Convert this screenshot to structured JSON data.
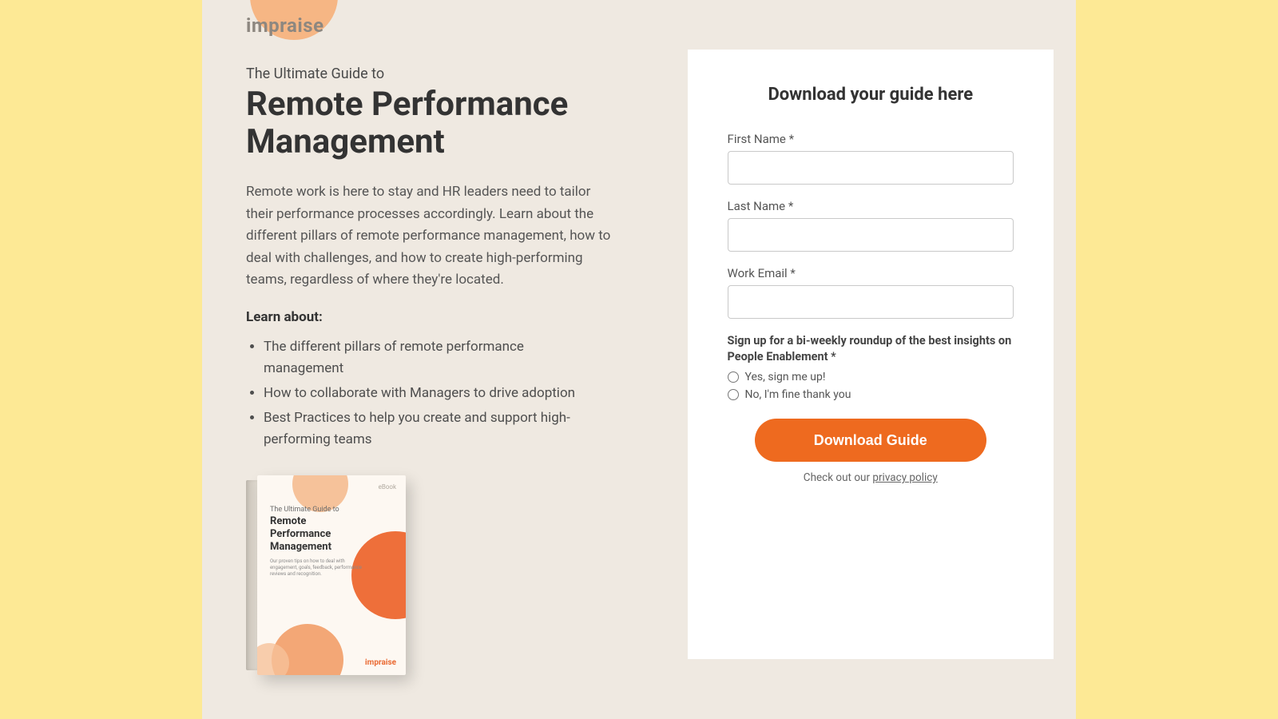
{
  "brand": "impraise",
  "left": {
    "kicker": "The Ultimate Guide to",
    "title": "Remote Performance Management",
    "lede": "Remote work is here to stay and HR leaders need to tailor their performance processes accordingly. Learn about the different pillars of remote performance management, how to deal with challenges, and how to create high-performing teams, regardless of where they're located.",
    "learn_label": "Learn about:",
    "bullets": [
      "The different pillars of remote performance management",
      "How to collaborate with Managers to drive adoption",
      "Best Practices to help you create and support high-performing teams"
    ],
    "book": {
      "kicker": "The Ultimate Guide to",
      "title": "Remote Performance Management",
      "sub": "Our proven tips on how to deal with engagement, goals, feedback, performance reviews and recognition.",
      "brand": "impraise"
    }
  },
  "form": {
    "heading": "Download your guide here",
    "first_name_label": "First Name *",
    "last_name_label": "Last Name *",
    "email_label": "Work Email *",
    "optin_question": "Sign up for a bi-weekly roundup of the best insights on People Enablement *",
    "optin_yes": "Yes, sign me up!",
    "optin_no": "No, I'm fine thank you",
    "cta": "Download Guide",
    "policy_prefix": "Check out our ",
    "policy_link": "privacy policy"
  }
}
